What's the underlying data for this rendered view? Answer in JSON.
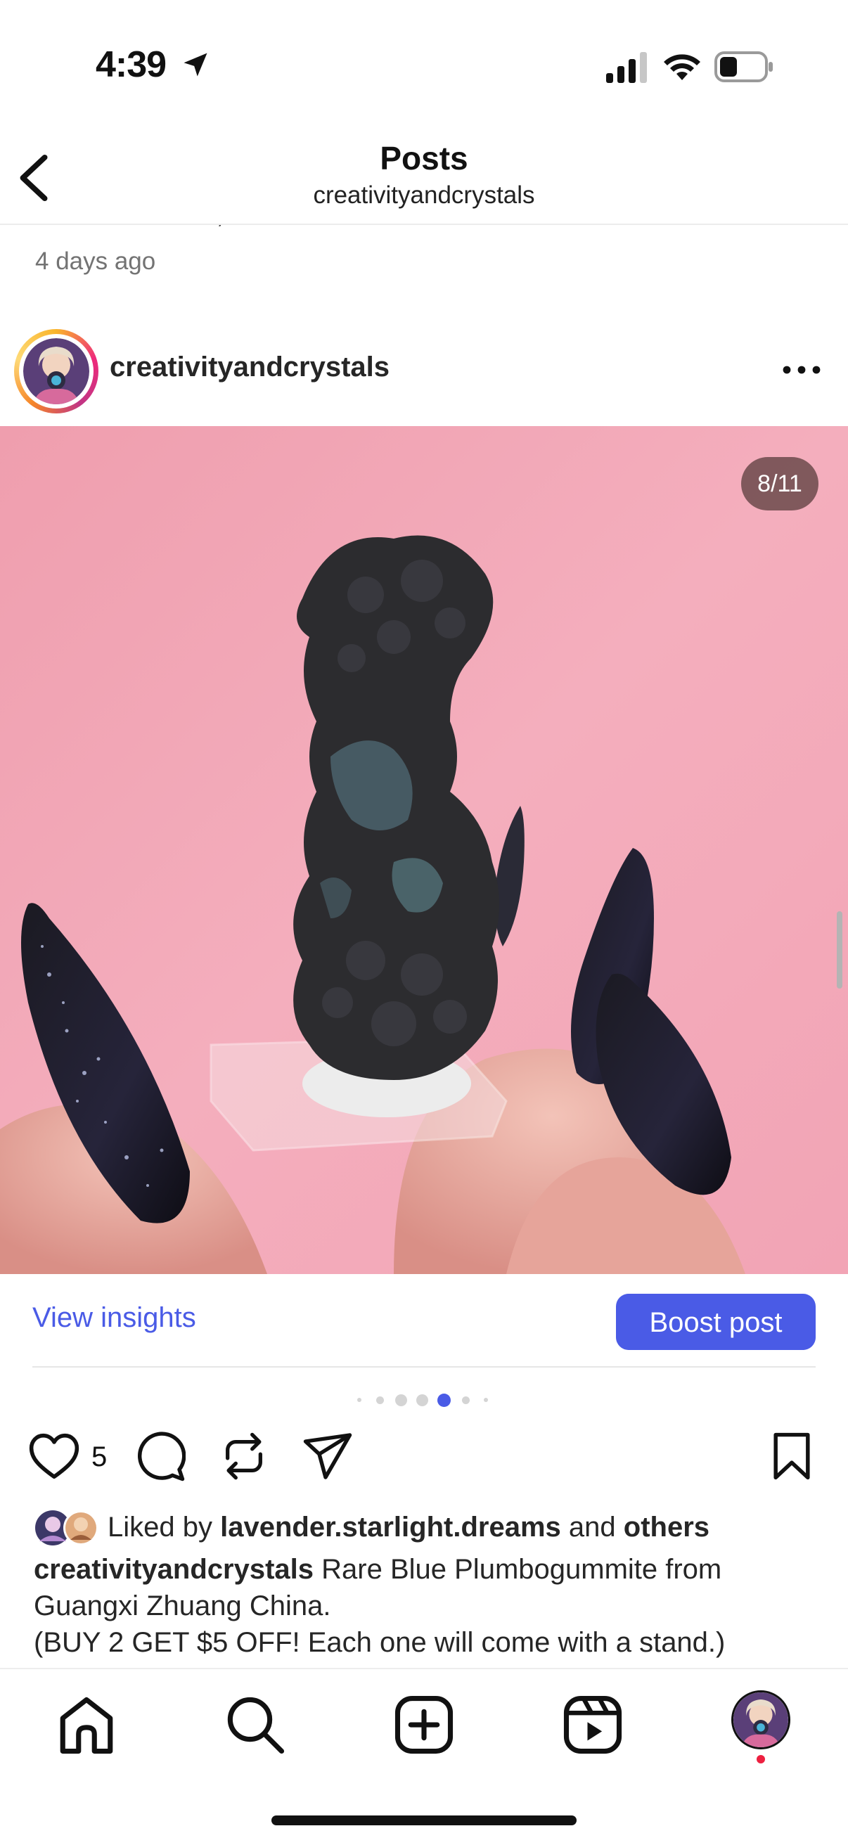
{
  "status_bar": {
    "time": "4:39",
    "icons": [
      "location-arrow-icon",
      "cellular-signal-icon",
      "wifi-icon",
      "battery-icon"
    ]
  },
  "header": {
    "title": "Posts",
    "subtitle": "creativityandcrystals",
    "back_icon": "chevron-left-icon"
  },
  "previous_post": {
    "caption_fragment": "Comment mine, sold & slide number/ letter to claim.",
    "timestamp": "4 days ago"
  },
  "post": {
    "username": "creativityandcrystals",
    "more_icon": "more-horizontal-icon",
    "carousel_counter": "8/11",
    "carousel_total": 11,
    "carousel_current": 8,
    "view_insights_label": "View insights",
    "boost_post_label": "Boost post",
    "like_count": "5",
    "actions": [
      "heart-icon",
      "comment-icon",
      "repost-icon",
      "share-icon",
      "bookmark-icon"
    ],
    "liked_by_prefix": "Liked by",
    "liked_by_user": "lavender.starlight.dreams",
    "liked_by_and": "and",
    "liked_by_others": "others",
    "caption_username": "creativityandcrystals",
    "caption_line1_text": "Rare Blue Plumbogummite from",
    "caption_line2": "Guangxi Zhuang China.",
    "caption_line3": "(BUY 2 GET $5 OFF! Each one will come with a stand.)"
  },
  "bottom_nav": {
    "items": [
      "home-icon",
      "search-icon",
      "create-icon",
      "reels-icon",
      "profile-avatar"
    ]
  },
  "colors": {
    "accent": "#4a5be6",
    "photo_background": "#f1a3b4",
    "notification_dot": "#ed2040"
  }
}
